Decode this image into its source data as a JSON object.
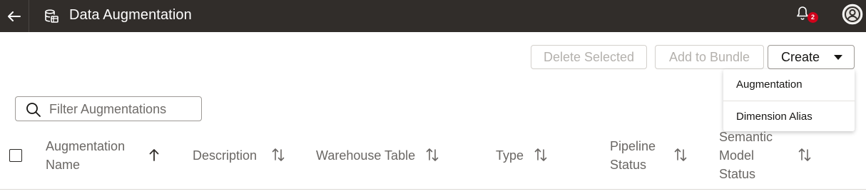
{
  "header": {
    "title": "Data Augmentation",
    "notification_count": "2",
    "icons": {
      "back": "arrow-left-icon",
      "app": "database-icon",
      "bell": "bell-icon",
      "avatar": "user-avatar-icon"
    }
  },
  "toolbar": {
    "delete_label": "Delete Selected",
    "bundle_label": "Add to Bundle",
    "create_label": "Create"
  },
  "create_menu": {
    "items": [
      "Augmentation",
      "Dimension Alias"
    ]
  },
  "filter": {
    "placeholder": "Filter Augmentations"
  },
  "table": {
    "columns": [
      {
        "lines": [
          "Augmentation",
          "Name"
        ],
        "sort": "ascending"
      },
      {
        "lines": [
          "Description"
        ],
        "sort": "none"
      },
      {
        "lines": [
          "Warehouse Table"
        ],
        "sort": "none"
      },
      {
        "lines": [
          "Type"
        ],
        "sort": "none"
      },
      {
        "lines": [
          "Pipeline",
          "Status"
        ],
        "sort": "none"
      },
      {
        "lines": [
          "Semantic",
          "Model",
          "Status"
        ],
        "sort": "none"
      }
    ]
  },
  "colors": {
    "topbar": "#312d2a",
    "badge": "#d0021b",
    "header_text": "#6a6764",
    "disabled_text": "#b4b1ad"
  }
}
